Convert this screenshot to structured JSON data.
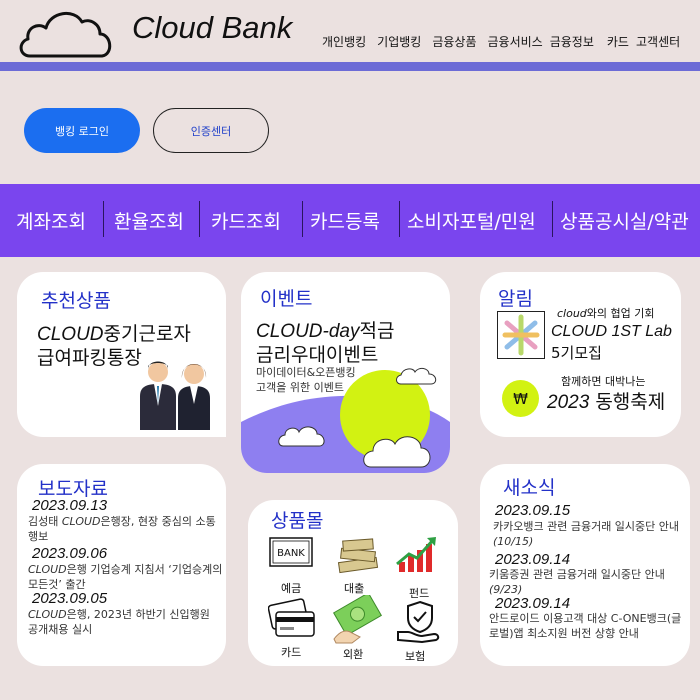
{
  "header": {
    "brand": "Cloud Bank",
    "nav": [
      "개인뱅킹",
      "기업뱅킹",
      "금융상품",
      "금융서비스",
      "금융정보",
      "카드",
      "고객센터"
    ]
  },
  "auth": {
    "login_label": "뱅킹 로그인",
    "cert_label": "인증센터"
  },
  "menu": [
    "계좌조회",
    "환율조회",
    "카드조회",
    "카드등록",
    "소비자포털/민원",
    "상품공시실/약관"
  ],
  "recommend": {
    "title": "추천상품",
    "product_line1_en": "CLOUD",
    "product_line1_ko": "중기근로자",
    "product_line2": "급여파킹통장"
  },
  "event": {
    "title": "이벤트",
    "line1_en": "CLOUD-day",
    "line1_ko": "적금",
    "line2": "금리우대이벤트",
    "sub1": "마이데이터&오픈뱅킹",
    "sub2": "고객을 위한 이벤트"
  },
  "notice": {
    "title": "알림",
    "collab_en": "cloud",
    "collab_ko": "와의 협업 기회",
    "lab_line1": "CLOUD 1ST Lab",
    "lab_line2": "5기모집",
    "festival_sub": "함께하면 대박나는",
    "festival_year": "2023",
    "festival_title": "동행축제",
    "won_symbol": "₩"
  },
  "press": {
    "title": "보도자료",
    "items": [
      {
        "date": "2023.09.13",
        "prefix": "김성태 ",
        "brand": "CLOUD",
        "text": "은행장, 현장 중심의 소통 행보"
      },
      {
        "date": "2023.09.06",
        "prefix": "",
        "brand": "CLOUD",
        "text": "은행 기업승계 지침서 ‘기업승계의 모든것’ 출간"
      },
      {
        "date": "2023.09.05",
        "prefix": "",
        "brand": "CLOUD",
        "text": "은행, 2023년 하반기 신입행원 공개채용 실시"
      }
    ]
  },
  "mall": {
    "title": "상품몰",
    "items": [
      {
        "label": "예금",
        "icon": "bank-icon"
      },
      {
        "label": "대출",
        "icon": "money-stack-icon"
      },
      {
        "label": "펀드",
        "icon": "growth-chart-icon"
      },
      {
        "label": "카드",
        "icon": "credit-card-icon"
      },
      {
        "label": "외환",
        "icon": "cash-hand-icon"
      },
      {
        "label": "보험",
        "icon": "shield-hand-icon"
      }
    ],
    "bank_sign": "BANK"
  },
  "news": {
    "title": "새소식",
    "items": [
      {
        "date": "2023.09.15",
        "text": "카카오뱅크 관련 금융거래 일시중단 안내",
        "sub": "(10/15)"
      },
      {
        "date": "2023.09.14",
        "text": "키움증권 관련 금융거래 일시중단 안내",
        "sub": "(9/23)"
      },
      {
        "date": "2023.09.14",
        "text": "안드로이드 이용고객 대상 C-ONE뱅크(글로벌)앱 최소지원 버전 상향 안내",
        "sub": ""
      }
    ]
  },
  "colors": {
    "accent_purple": "#7a45ee",
    "header_line": "#6c6bd6",
    "login_blue": "#1b6ef0",
    "title_blue": "#2331c8",
    "event_lime": "#d2f212"
  }
}
